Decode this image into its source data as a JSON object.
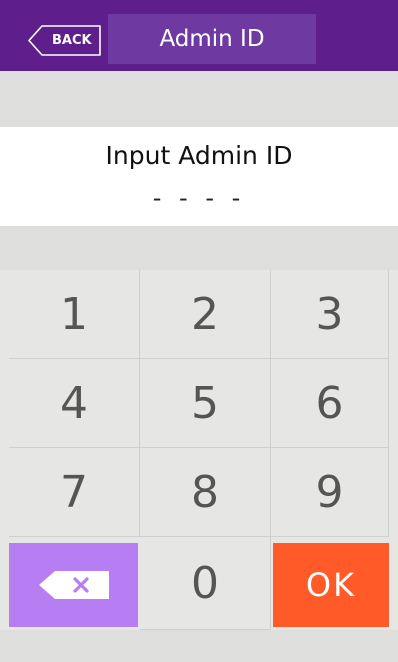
{
  "header": {
    "back_label": "BACK",
    "title": "Admin ID"
  },
  "prompt": {
    "label": "Input Admin ID",
    "value": "- - - -"
  },
  "keypad": {
    "keys": [
      "1",
      "2",
      "3",
      "4",
      "5",
      "6",
      "7",
      "8",
      "9"
    ],
    "zero": "0",
    "ok": "OK",
    "delete_icon": "backspace-icon"
  },
  "colors": {
    "header_bg": "#5e1e8c",
    "title_box_bg": "#6e39a1",
    "delete_bg": "#b67ef2",
    "ok_bg": "#ff5a28",
    "keypad_bg": "#e6e6e4"
  }
}
